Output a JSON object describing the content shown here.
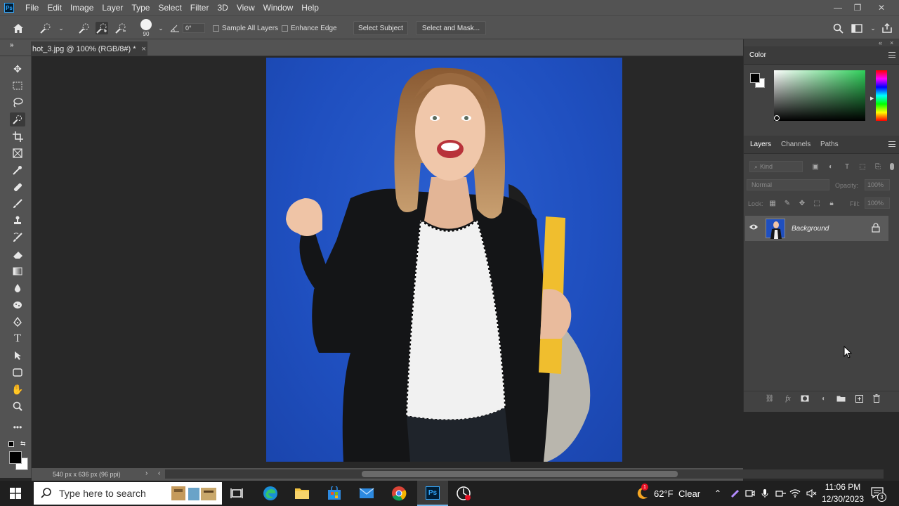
{
  "menubar": {
    "app_logo": "Ps",
    "items": [
      "File",
      "Edit",
      "Image",
      "Layer",
      "Type",
      "Select",
      "Filter",
      "3D",
      "View",
      "Window",
      "Help"
    ],
    "min_glyph": "—",
    "max_glyph": "❐",
    "close_glyph": "✕"
  },
  "optionsbar": {
    "brush_size": "90",
    "angle": "0°",
    "sample_all_layers": "Sample All Layers",
    "enhance_edge": "Enhance Edge",
    "select_subject": "Select Subject",
    "select_and_mask": "Select and Mask..."
  },
  "document": {
    "tab_title": "hot_3.jpg @ 100% (RGB/8#) *",
    "close_glyph": "×",
    "status": "540 px x 636 px (96 ppi)"
  },
  "color_panel": {
    "title": "Color",
    "foreground": "#000000",
    "background": "#ffffff",
    "hue": "#2fcf5a"
  },
  "layers_panel": {
    "tabs": [
      "Layers",
      "Channels",
      "Paths"
    ],
    "filter_placeholder": "Kind",
    "blend_mode": "Normal",
    "opacity_label": "Opacity:",
    "opacity_value": "100%",
    "lock_label": "Lock:",
    "fill_label": "Fill:",
    "fill_value": "100%",
    "layers": [
      {
        "name": "Background",
        "visible": true,
        "locked": true
      }
    ]
  },
  "taskbar": {
    "search_placeholder": "Type here to search",
    "weather_temp": "62°F",
    "weather_desc": "Clear",
    "time": "11:06 PM",
    "date": "12/30/2023",
    "notification_count": "3",
    "weather_badge": "1"
  }
}
